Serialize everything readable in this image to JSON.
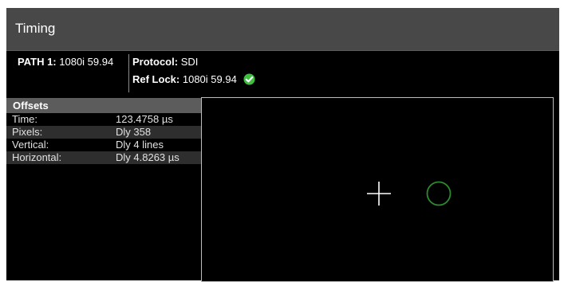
{
  "window": {
    "title": "Timing"
  },
  "status": {
    "path_label": "PATH 1:",
    "path_value": "1080i 59.94",
    "protocol_label": "Protocol:",
    "protocol_value": "SDI",
    "ref_lock_label": "Ref Lock:",
    "ref_lock_value": "1080i 59.94",
    "ref_lock_icon": "check-circle-icon",
    "ref_lock_color": "#3fbf3f"
  },
  "offsets": {
    "header": "Offsets",
    "rows": [
      {
        "label": "Time:",
        "value": "123.4758 µs"
      },
      {
        "label": "Pixels:",
        "value": "Dly 358"
      },
      {
        "label": "Vertical:",
        "value": "Dly 4 lines"
      },
      {
        "label": "Horizontal:",
        "value": "Dly 4.8263 µs"
      }
    ]
  },
  "display": {
    "reference_marker_icon": "crosshair-icon",
    "input_marker_icon": "circle-marker-icon",
    "input_marker_color": "#2e8a2e"
  }
}
